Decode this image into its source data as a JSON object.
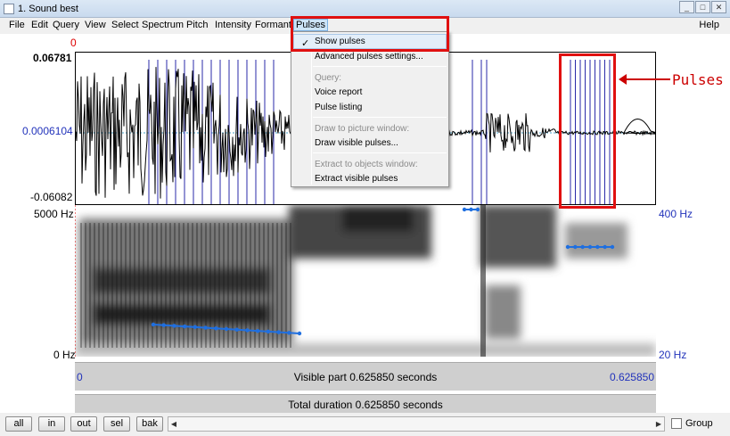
{
  "window": {
    "title": "1. Sound best",
    "controls": [
      "_",
      "□",
      "✕"
    ]
  },
  "menubar": {
    "items": [
      "File",
      "Edit",
      "Query",
      "View",
      "Select",
      "Spectrum",
      "Pitch",
      "Intensity",
      "Formant",
      "Pulses"
    ],
    "help": "Help"
  },
  "waveform": {
    "y_max": "0.06781",
    "y_mid": "0.0006104",
    "y_min": "-0.06082",
    "cursor_label": "0"
  },
  "spectrogram": {
    "freq_top": "5000 Hz",
    "freq_bottom": "0 Hz",
    "pitch_top": "400 Hz",
    "pitch_bottom": "20 Hz"
  },
  "visible_bar": {
    "start": "0",
    "text": "Visible part 0.625850 seconds",
    "end": "0.625850"
  },
  "total_bar": {
    "text": "Total duration 0.625850 seconds"
  },
  "bottom": {
    "buttons": [
      "all",
      "in",
      "out",
      "sel",
      "bak"
    ],
    "group_label": "Group"
  },
  "pulses_menu": {
    "checked_item": "Show pulses",
    "advanced": "Advanced pulses settings...",
    "query_header": "Query:",
    "voice_report": "Voice report",
    "pulse_listing": "Pulse listing",
    "draw_header": "Draw to picture window:",
    "draw_visible": "Draw visible pulses...",
    "extract_header": "Extract to objects window:",
    "extract_visible": "Extract visible pulses"
  },
  "annotation": {
    "callout": "Pulses",
    "highlight_color": "#e01010"
  },
  "colors": {
    "pulse_lines": "#2a2aa8",
    "pitch_track": "#1f6fe0",
    "axis_blue": "#2233bb",
    "axis_red": "#dd0000"
  }
}
